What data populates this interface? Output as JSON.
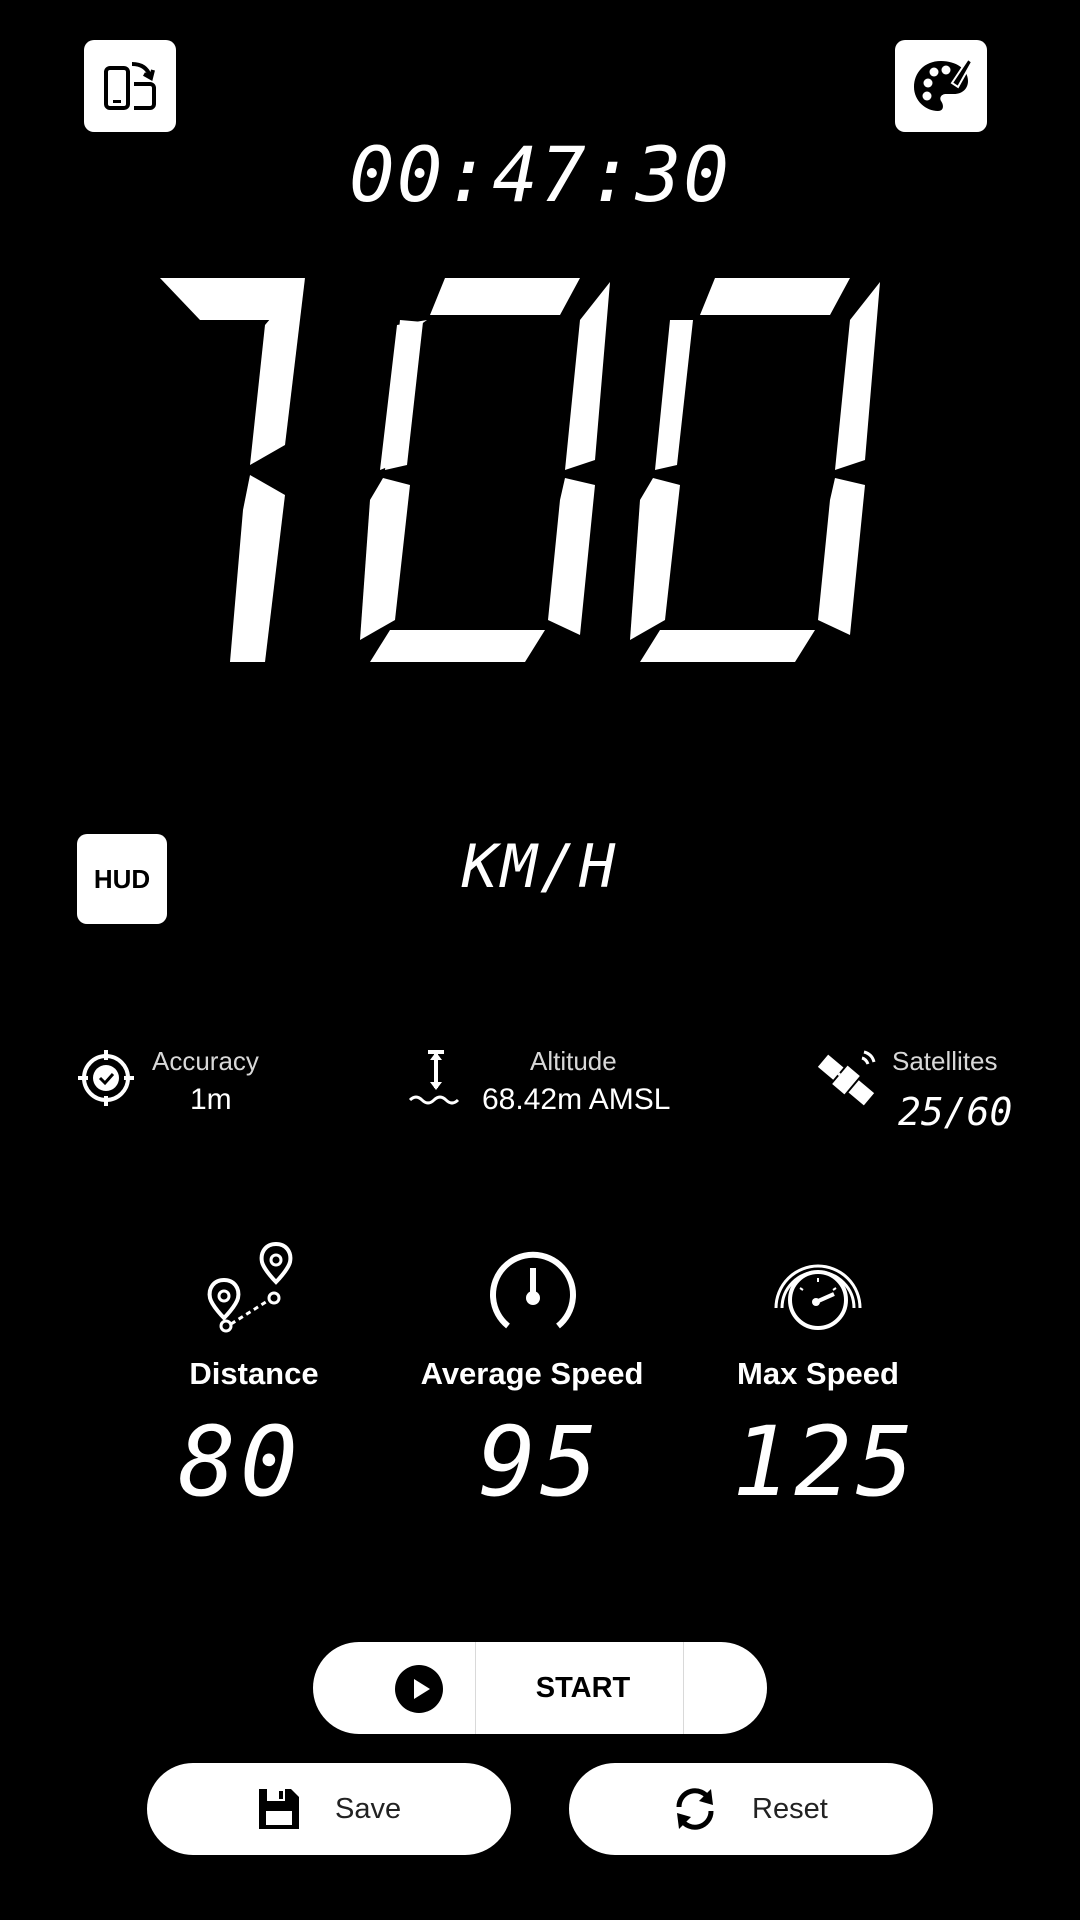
{
  "timer": "00:47:30",
  "speed": "100",
  "unit": "KM/H",
  "hud_label": "HUD",
  "info": {
    "accuracy": {
      "label": "Accuracy",
      "value": "1m"
    },
    "altitude": {
      "label": "Altitude",
      "value": "68.42m AMSL"
    },
    "satellites": {
      "label": "Satellites",
      "value": "25/60"
    }
  },
  "stats": {
    "distance": {
      "label": "Distance",
      "value": "80"
    },
    "average_speed": {
      "label": "Average Speed",
      "value": "95"
    },
    "max_speed": {
      "label": "Max Speed",
      "value": "125"
    }
  },
  "buttons": {
    "start": "START",
    "save": "Save",
    "reset": "Reset"
  },
  "icons": {
    "rotate": "rotate-screen-icon",
    "theme": "palette-icon",
    "accuracy": "target-check-icon",
    "altitude": "altitude-icon",
    "satellite": "satellite-icon",
    "distance": "route-pins-icon",
    "avg": "speedometer-icon",
    "max": "gauge-icon",
    "play": "play-icon",
    "save": "floppy-disk-icon",
    "reset": "refresh-icon"
  }
}
